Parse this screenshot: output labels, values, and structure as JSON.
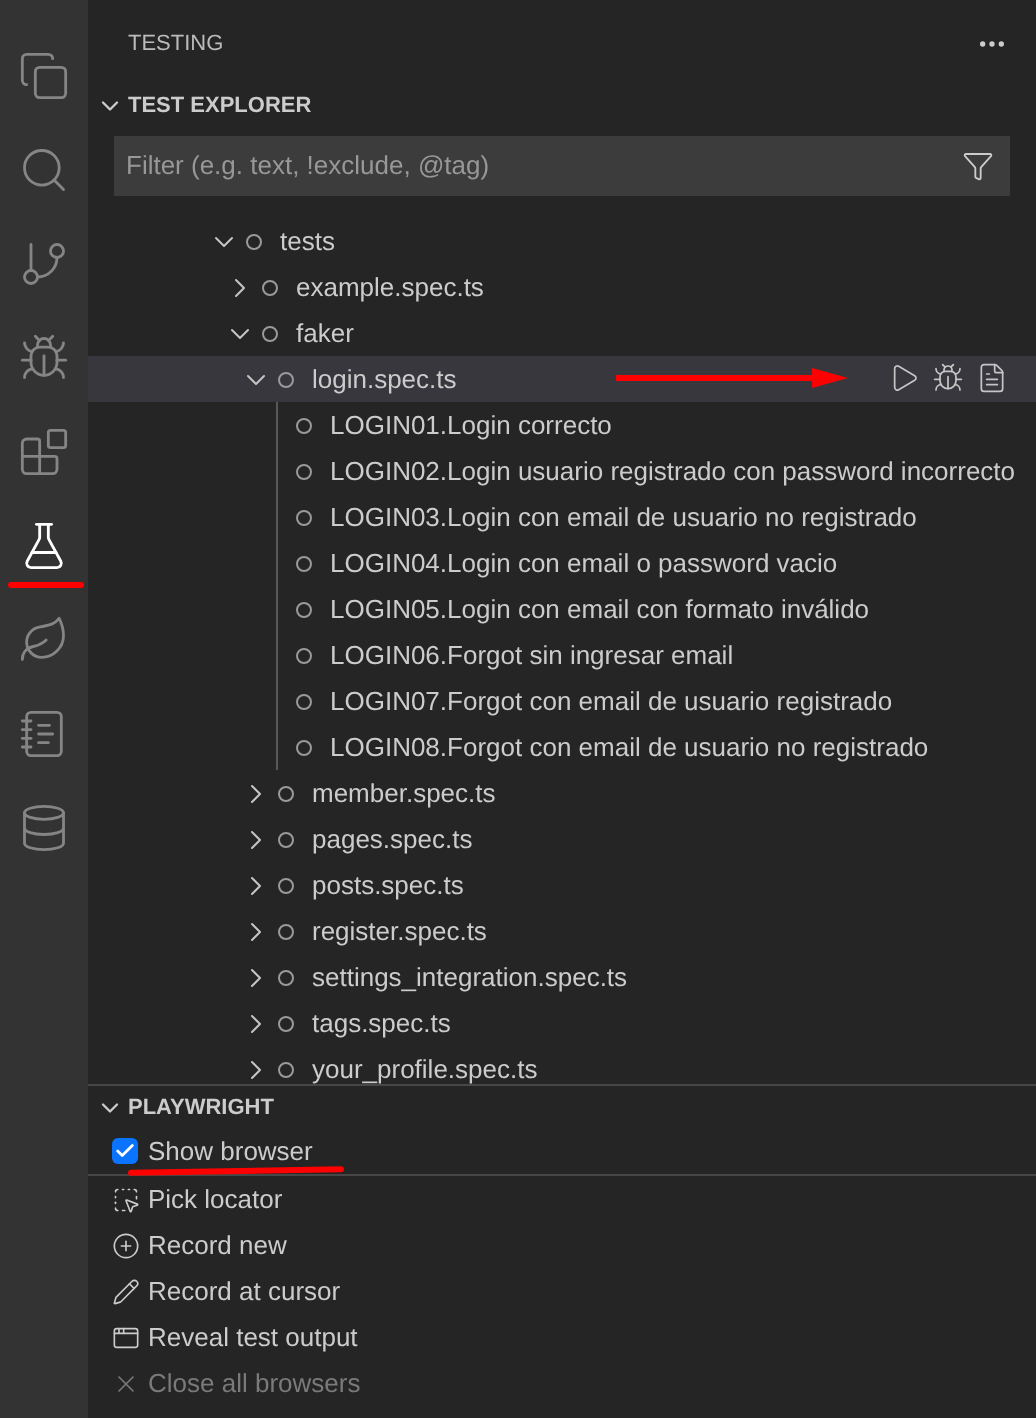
{
  "activity_bar": [
    {
      "kind": "files",
      "selected": false
    },
    {
      "kind": "search",
      "selected": false
    },
    {
      "kind": "source-control",
      "selected": false
    },
    {
      "kind": "run-debug",
      "selected": false
    },
    {
      "kind": "extensions",
      "selected": false
    },
    {
      "kind": "testing",
      "selected": true
    },
    {
      "kind": "leaf",
      "selected": false
    },
    {
      "kind": "notebook",
      "selected": false
    },
    {
      "kind": "database",
      "selected": false
    }
  ],
  "sidebar": {
    "title": "TESTING"
  },
  "test_explorer": {
    "title": "TEST EXPLORER",
    "expanded": true,
    "filter": {
      "placeholder": "Filter (e.g. text, !exclude, @tag)"
    },
    "tree": [
      {
        "label": "tests",
        "kind": "group",
        "expanded": true,
        "selected": false,
        "children": [
          {
            "label": "example.spec.ts",
            "kind": "group",
            "expanded": false,
            "selected": false
          },
          {
            "label": "faker",
            "kind": "group",
            "expanded": true,
            "selected": false,
            "children": [
              {
                "label": "login.spec.ts",
                "kind": "group",
                "expanded": true,
                "selected": true,
                "children": [
                  {
                    "label": "LOGIN01.Login correcto",
                    "kind": "test",
                    "selected": false
                  },
                  {
                    "label": "LOGIN02.Login usuario registrado con password incorrecto",
                    "kind": "test",
                    "selected": false
                  },
                  {
                    "label": "LOGIN03.Login con email de usuario no registrado",
                    "kind": "test",
                    "selected": false
                  },
                  {
                    "label": "LOGIN04.Login con email o password vacio",
                    "kind": "test",
                    "selected": false
                  },
                  {
                    "label": "LOGIN05.Login con email con formato inválido",
                    "kind": "test",
                    "selected": false
                  },
                  {
                    "label": "LOGIN06.Forgot sin ingresar email",
                    "kind": "test",
                    "selected": false
                  },
                  {
                    "label": "LOGIN07.Forgot con email de usuario registrado",
                    "kind": "test",
                    "selected": false
                  },
                  {
                    "label": "LOGIN08.Forgot con email de usuario no registrado",
                    "kind": "test",
                    "selected": false
                  }
                ]
              },
              {
                "label": "member.spec.ts",
                "kind": "group",
                "expanded": false,
                "selected": false
              },
              {
                "label": "pages.spec.ts",
                "kind": "group",
                "expanded": false,
                "selected": false
              },
              {
                "label": "posts.spec.ts",
                "kind": "group",
                "expanded": false,
                "selected": false
              },
              {
                "label": "register.spec.ts",
                "kind": "group",
                "expanded": false,
                "selected": false
              },
              {
                "label": "settings_integration.spec.ts",
                "kind": "group",
                "expanded": false,
                "selected": false
              },
              {
                "label": "tags.spec.ts",
                "kind": "group",
                "expanded": false,
                "selected": false
              },
              {
                "label": "your_profile.spec.ts",
                "kind": "group",
                "expanded": false,
                "selected": false
              }
            ]
          }
        ]
      }
    ]
  },
  "playwright": {
    "title": "PLAYWRIGHT",
    "expanded": true,
    "items": [
      {
        "label": "Show browser",
        "kind": "checkbox",
        "checked": true,
        "disabled": false
      },
      {
        "label": "Pick locator",
        "kind": "pick",
        "disabled": false
      },
      {
        "label": "Record new",
        "kind": "record",
        "disabled": false
      },
      {
        "label": "Record at cursor",
        "kind": "pencil",
        "disabled": false
      },
      {
        "label": "Reveal test output",
        "kind": "output",
        "disabled": false
      },
      {
        "label": "Close all browsers",
        "kind": "close",
        "disabled": true
      }
    ]
  }
}
